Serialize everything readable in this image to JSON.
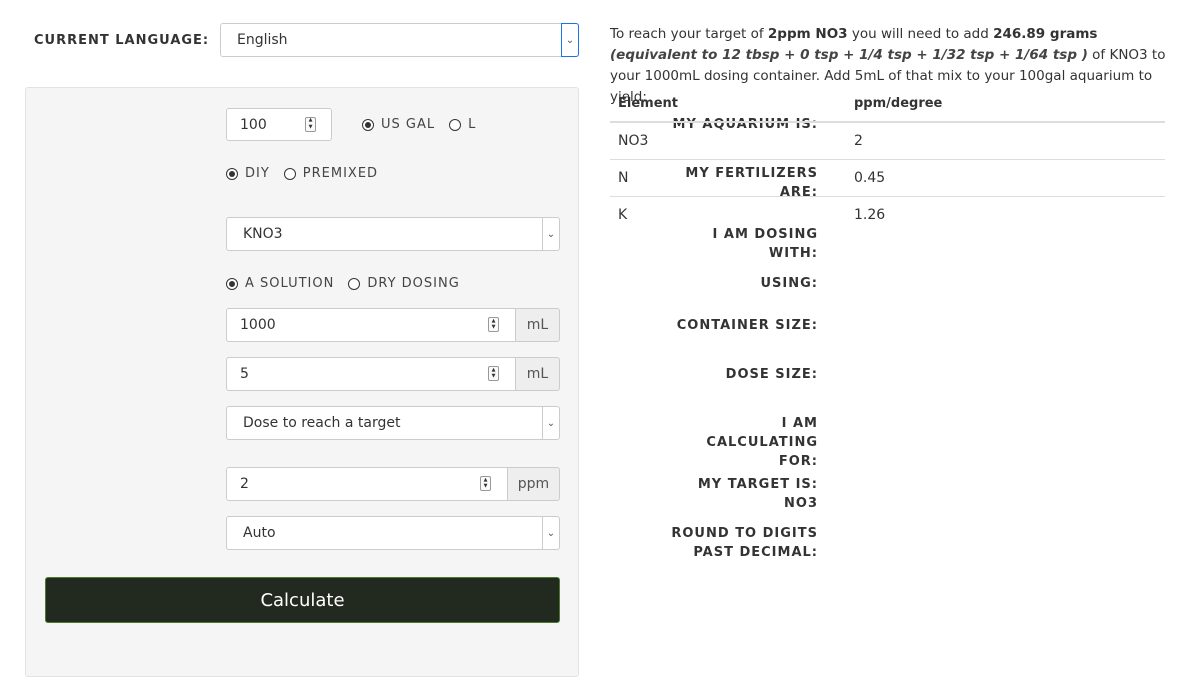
{
  "language": {
    "label": "CURRENT LANGUAGE:",
    "selected": "English"
  },
  "form": {
    "aquarium": {
      "label": "MY AQUARIUM IS:",
      "value": "100",
      "units": [
        "US GAL",
        "L"
      ],
      "selected_unit": "US GAL"
    },
    "fertilizers": {
      "label": "MY FERTILIZERS ARE:",
      "options": [
        "DIY",
        "PREMIXED"
      ],
      "selected": "DIY"
    },
    "dosing_with": {
      "label": "I AM DOSING WITH:",
      "selected": "KNO3"
    },
    "using": {
      "label": "USING:",
      "options": [
        "A SOLUTION",
        "DRY DOSING"
      ],
      "selected": "A SOLUTION"
    },
    "container_size": {
      "label": "CONTAINER SIZE:",
      "value": "1000",
      "unit": "mL"
    },
    "dose_size": {
      "label": "DOSE SIZE:",
      "value": "5",
      "unit": "mL"
    },
    "calculating_for": {
      "label": "I AM CALCULATING FOR:",
      "selected": "Dose to reach a target"
    },
    "target": {
      "label": "MY TARGET IS: NO3",
      "value": "2",
      "unit": "ppm"
    },
    "round_digits": {
      "label": "ROUND TO DIGITS PAST DECIMAL:",
      "selected": "Auto"
    },
    "calculate_label": "Calculate"
  },
  "result": {
    "t1": "To reach your target of ",
    "target_strong": "2ppm NO3",
    "t2": " you will need to add ",
    "grams_strong": "246.89 grams",
    "t3": " ",
    "equiv_italic": "(equivalent to 12 tbsp + 0 tsp + 1/4 tsp + 1/32 tsp + 1/64 tsp )",
    "t4": " of KNO3 to your 1000mL dosing container. Add 5mL of that mix to your 100gal aquarium to yield:"
  },
  "table": {
    "headers": [
      "Element",
      "ppm/degree"
    ],
    "rows": [
      [
        "NO3",
        "2"
      ],
      [
        "N",
        "0.45"
      ],
      [
        "K",
        "1.26"
      ]
    ]
  },
  "colors": {
    "button_bg": "#222a20",
    "button_border": "#4a7a2e",
    "panel_bg": "#f5f5f5"
  }
}
